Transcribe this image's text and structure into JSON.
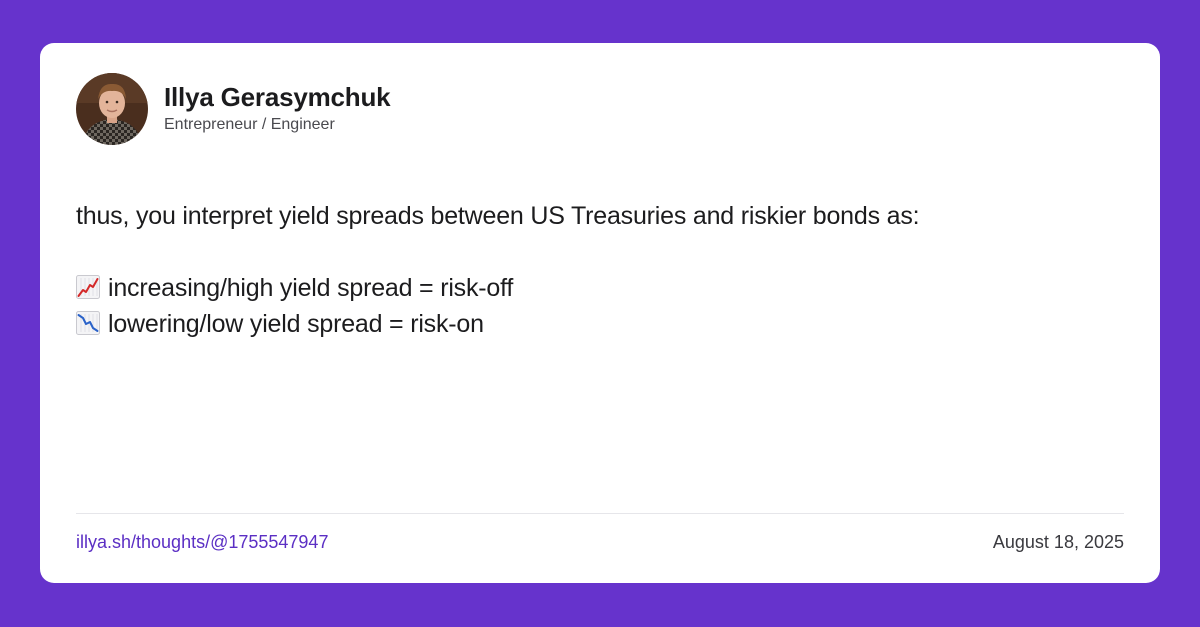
{
  "author": {
    "name": "Illya Gerasymchuk",
    "role": "Entrepreneur / Engineer"
  },
  "post": {
    "intro": "thus, you interpret yield spreads between US Treasuries and riskier bonds as:",
    "points": [
      {
        "icon": "chart-increasing-icon",
        "text": "increasing/high yield spread = risk-off"
      },
      {
        "icon": "chart-decreasing-icon",
        "text": "lowering/low yield spread = risk-on"
      }
    ]
  },
  "footer": {
    "link": "illya.sh/thoughts/@1755547947",
    "date": "August 18, 2025"
  },
  "colors": {
    "background": "#6633cc",
    "card": "#ffffff",
    "link": "#5b2fc4",
    "chart_up": "#d42a2a",
    "chart_down": "#2a62c9"
  }
}
